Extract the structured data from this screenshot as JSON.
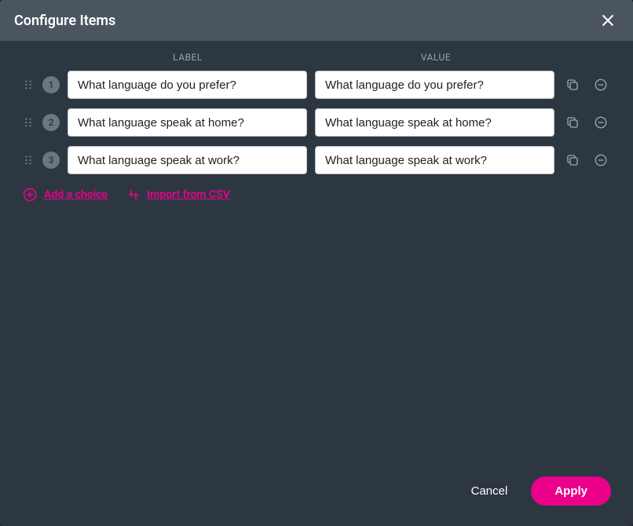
{
  "dialog": {
    "title": "Configure Items",
    "columns": {
      "label": "LABEL",
      "value": "VALUE"
    },
    "rows": [
      {
        "num": "1",
        "label": "What language do you prefer?",
        "value": "What language do you prefer?"
      },
      {
        "num": "2",
        "label": "What language speak at home?",
        "value": "What language speak at home?"
      },
      {
        "num": "3",
        "label": "What language speak at work?",
        "value": "What language speak at work?"
      }
    ],
    "addChoice": "Add a choice",
    "importCsv": "Import from CSV",
    "cancel": "Cancel",
    "apply": "Apply"
  }
}
